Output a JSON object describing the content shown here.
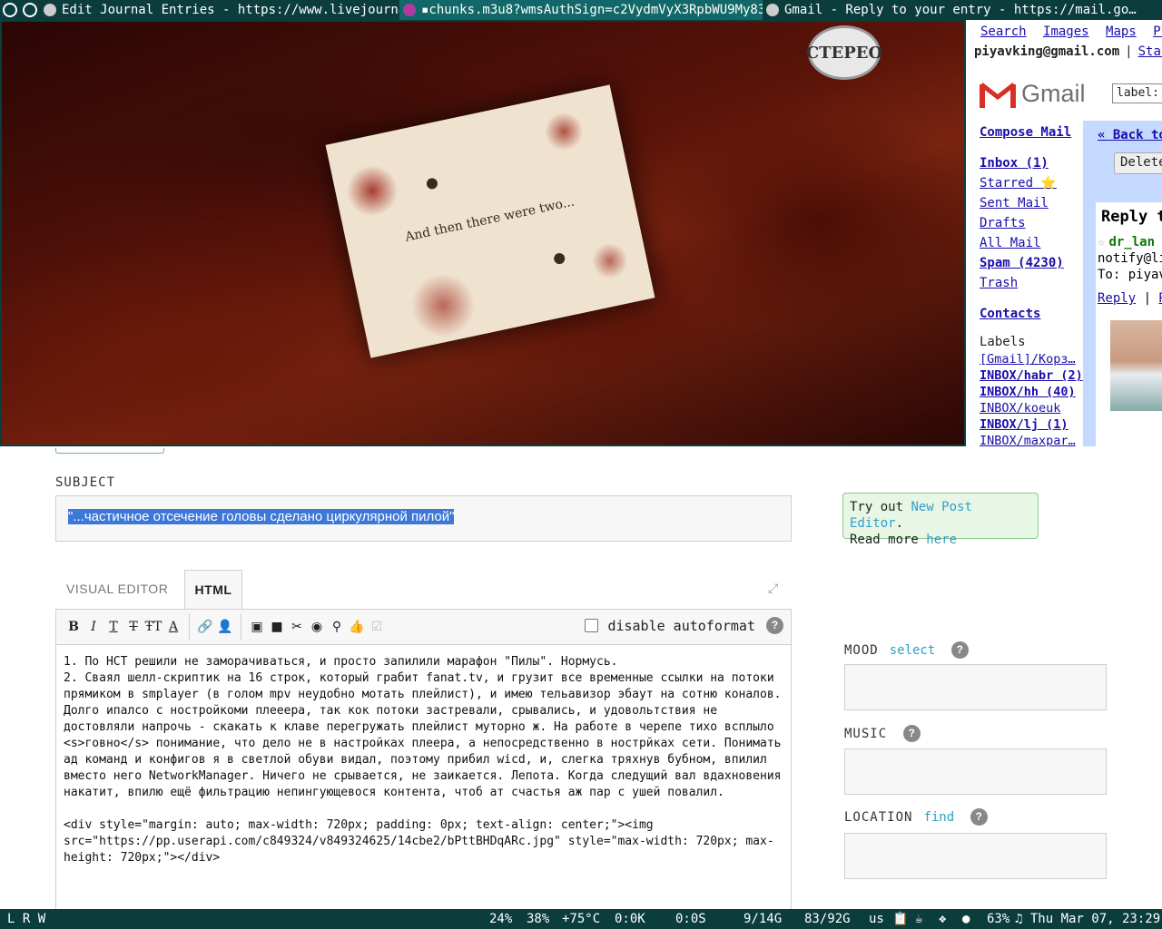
{
  "taskbar": {
    "tasks": [
      {
        "title": "Edit Journal Entries - https://www.livejourna…"
      },
      {
        "title": "▪chunks.m3u8?wmsAuthSign=c2VydmVyX3RpbWU9My83…"
      },
      {
        "title": "Gmail - Reply to your entry - https://mail.go…"
      }
    ]
  },
  "video": {
    "card_text": "And then there were two...",
    "watermark": "СТЕРЕО"
  },
  "gmail": {
    "top_links": [
      "Search",
      "Images",
      "Maps",
      "Pla"
    ],
    "top_links_partial": "Star",
    "account": "piyavking@gmail.com",
    "logo_text": "Gmail",
    "search_value": "label:",
    "nav": [
      {
        "label": "Compose Mail",
        "bold": true
      },
      {
        "label": "Inbox (1)",
        "bold": true
      },
      {
        "label": "Starred ⭐",
        "bold": false
      },
      {
        "label": "Sent Mail",
        "bold": false
      },
      {
        "label": "Drafts",
        "bold": false
      },
      {
        "label": "All Mail",
        "bold": false
      },
      {
        "label": "Spam (4230)",
        "bold": true
      },
      {
        "label": "Trash",
        "bold": false
      },
      {
        "label": "Contacts",
        "bold": true
      }
    ],
    "labels_title": "Labels",
    "labels": [
      {
        "label": "[Gmail]/Корз…",
        "bold": false
      },
      {
        "label": "INBOX/habr (2)",
        "bold": true
      },
      {
        "label": "INBOX/hh (40)",
        "bold": true
      },
      {
        "label": "INBOX/koeuk",
        "bold": false
      },
      {
        "label": "INBOX/lj (1)",
        "bold": true
      },
      {
        "label": "INBOX/maxpar…",
        "bold": false
      }
    ],
    "back_link": "« Back to",
    "delete_button": "Delete",
    "reply_title": "Reply to",
    "from_name": "dr_lan",
    "notify": "notify@liv",
    "to": "To: piyavk",
    "action_reply": "Reply",
    "action_sep": "|",
    "action_more": "Re"
  },
  "editor": {
    "subject_label": "SUBJECT",
    "subject_value": "\"...частичное отсечение головы сделано циркулярной пилой\"",
    "tabs": {
      "visual": "VISUAL EDITOR",
      "html": "HTML"
    },
    "disable_autoformat": "disable autoformat",
    "body": "1. По НСТ решили не заморачиваться, и просто запилили марафон \"Пилы\". Нормусь.\n2. Сваял шелл-скриптик на 16 строк, который грабит fanat.tv, и грузит все временные ссылки на потоки прямиком в smplayer (в голом mpv неудобно мотать плейлист), и имею тельавизор эбаут на сотню коналов. Долго ипалсо с ностройкоми плееера, так кок потоки застревали, срывались, и удовольтствия не достовляли напрочь - скакать к клаве перегружать плейлист муторно ж. На работе в черепе тихо всплыло <s>говно</s> понимание, что дело не в настройках плеера, а непосредственно в нострйках сети. Понимать ад команд и конфигов я в светлой обуви видал, поэтому прибил wicd, и, слегка тряхнув бубном, впилил вместо него NetworkManager. Ничего не срывается, не заикается. Лепота. Когда следущий вал вдахновения накатит, впилю ещё фильтрацию непингующевося контента, чтоб ат счастья аж пар с ушей повалил.\n\n<div style=\"margin: auto; max-width: 720px; padding: 0px; text-align: center;\"><img src=\"https://pp.userapi.com/c849324/v849324625/14cbe2/bPttBHDqARc.jpg\" style=\"max-width: 720px; max-height: 720px;\"></div>",
    "promo_prefix": "Try out ",
    "promo_link": "New Post Editor",
    "promo_mid": ".",
    "promo_line2": "Read more ",
    "promo_link2": "here",
    "mood_label": "MOOD",
    "mood_action": "select",
    "music_label": "MUSIC",
    "location_label": "LOCATION",
    "location_action": "find",
    "help_glyph": "?"
  },
  "status": {
    "left": "L R W",
    "cpu": "24%",
    "mem": "38%",
    "temp": "+75°C",
    "net": "0:0K",
    "io": "0:0S",
    "swap": "9/14G",
    "disk": "83/92G",
    "layout": "us",
    "battery": "63%",
    "clock": "♫ Thu Mar 07, 23:29"
  },
  "colors": {
    "taskbar_bg": "#0b3d3d",
    "link": "#1a0dab",
    "accent": "#2f9fc8",
    "selection": "#3c78d8"
  }
}
